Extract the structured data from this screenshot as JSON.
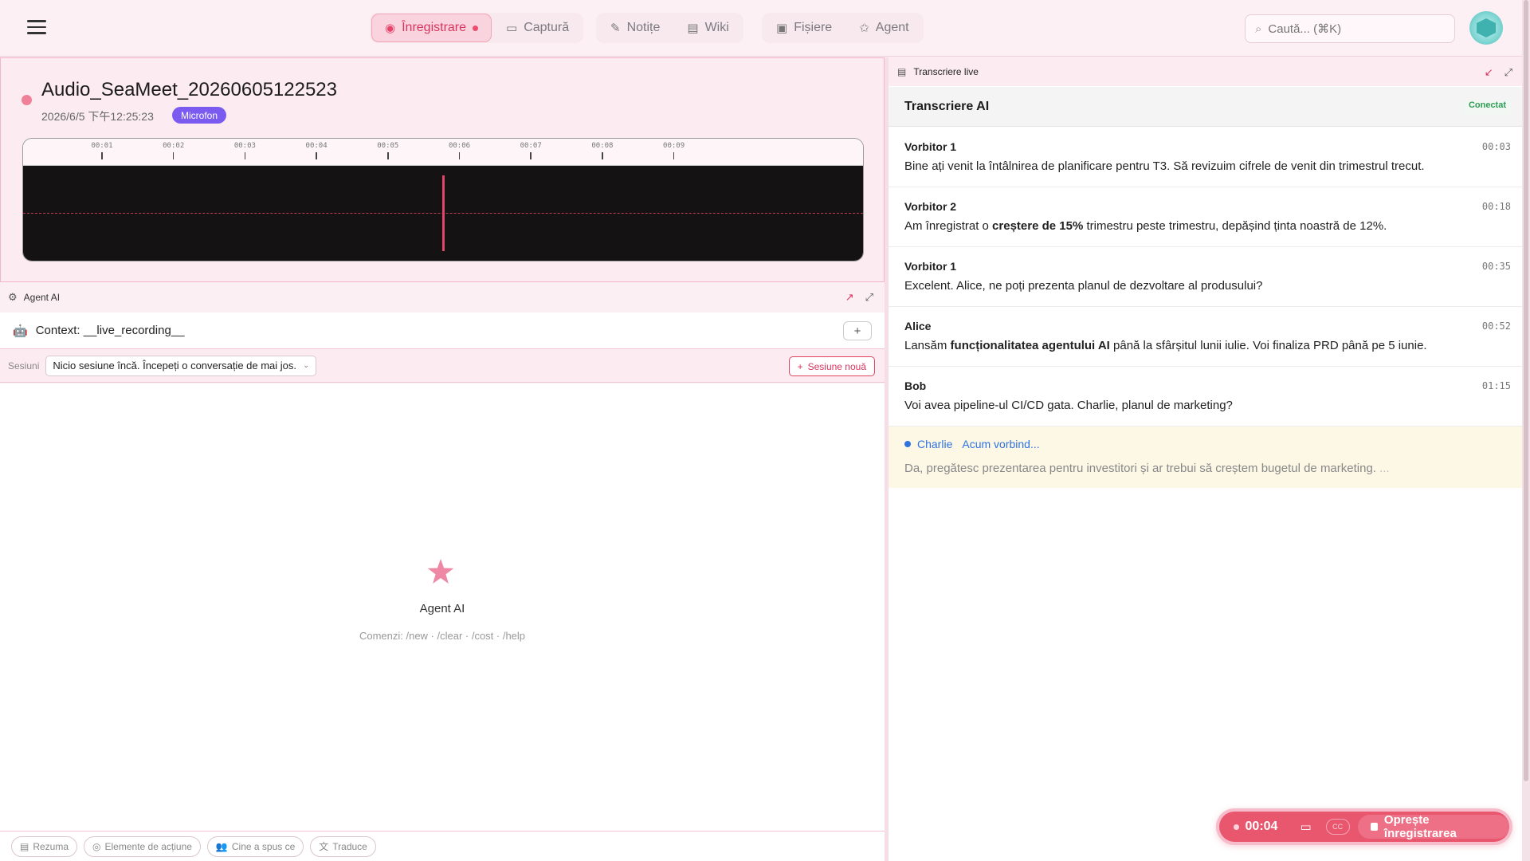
{
  "nav": {
    "groups": [
      [
        {
          "label": "Înregistrare",
          "icon": "record-icon",
          "active": true
        },
        {
          "label": "Captură",
          "icon": "monitor-icon",
          "active": false
        }
      ],
      [
        {
          "label": "Notițe",
          "icon": "note-icon",
          "active": false
        },
        {
          "label": "Wiki",
          "icon": "book-icon",
          "active": false
        }
      ],
      [
        {
          "label": "Fișiere",
          "icon": "files-icon",
          "active": false
        },
        {
          "label": "Agent",
          "icon": "agent-icon",
          "active": false
        }
      ]
    ]
  },
  "search": {
    "placeholder": "Caută... (⌘K)"
  },
  "recording": {
    "title": "Audio_SeaMeet_20260605122523",
    "date": "2026/6/5 下午12:25:23",
    "source_badge": "Microfon",
    "ticks": [
      "00:01",
      "00:02",
      "00:03",
      "00:04",
      "00:05",
      "00:06",
      "00:07",
      "00:08",
      "00:09"
    ]
  },
  "agent": {
    "panel_title": "Agent AI",
    "context_label": "Context: __live_recording__",
    "sessions_label": "Sesiuni",
    "session_select": "Nicio sesiune încă. Începeți o conversație de mai jos.",
    "new_session": "Sesiune nouă",
    "empty_title": "Agent AI",
    "commands": "Comenzi: /new · /clear · /cost · /help",
    "quick_actions": [
      {
        "label": "Rezuma",
        "icon": "document-icon"
      },
      {
        "label": "Elemente de acțiune",
        "icon": "check-circle-icon"
      },
      {
        "label": "Cine a spus ce",
        "icon": "people-icon"
      },
      {
        "label": "Traduce",
        "icon": "translate-icon"
      }
    ]
  },
  "transcript": {
    "panel_title": "Transcriere live",
    "ai_title": "Transcriere AI",
    "status": "Conectat",
    "entries": [
      {
        "speaker": "Vorbitor 1",
        "time": "00:03",
        "parts": [
          {
            "t": "Bine ați venit la întâlnirea de planificare pentru T3. Să revizuim cifrele de venit din trimestrul trecut."
          }
        ]
      },
      {
        "speaker": "Vorbitor 2",
        "time": "00:18",
        "parts": [
          {
            "t": "Am înregistrat o "
          },
          {
            "t": "creștere de 15%",
            "b": true
          },
          {
            "t": " trimestru peste trimestru, depășind ținta noastră de 12%."
          }
        ]
      },
      {
        "speaker": "Vorbitor 1",
        "time": "00:35",
        "parts": [
          {
            "t": "Excelent. Alice, ne poți prezenta planul de dezvoltare al produsului?"
          }
        ]
      },
      {
        "speaker": "Alice",
        "time": "00:52",
        "parts": [
          {
            "t": "Lansăm "
          },
          {
            "t": "funcționalitatea agentului AI",
            "b": true
          },
          {
            "t": " până la sfârșitul lunii iulie. Voi finaliza PRD până pe 5 iunie."
          }
        ]
      },
      {
        "speaker": "Bob",
        "time": "01:15",
        "parts": [
          {
            "t": "Voi avea pipeline-ul CI/CD gata. Charlie, planul de marketing?"
          }
        ]
      }
    ],
    "live": {
      "speaker": "Charlie",
      "status": "Acum vorbind...",
      "text": "Da, pregătesc prezentarea pentru investitori și ar trebui să creștem bugetul de marketing.",
      "ellipsis": "..."
    }
  },
  "control": {
    "elapsed": "00:04",
    "cc": "CC",
    "stop_label": "Oprește înregistrarea"
  }
}
